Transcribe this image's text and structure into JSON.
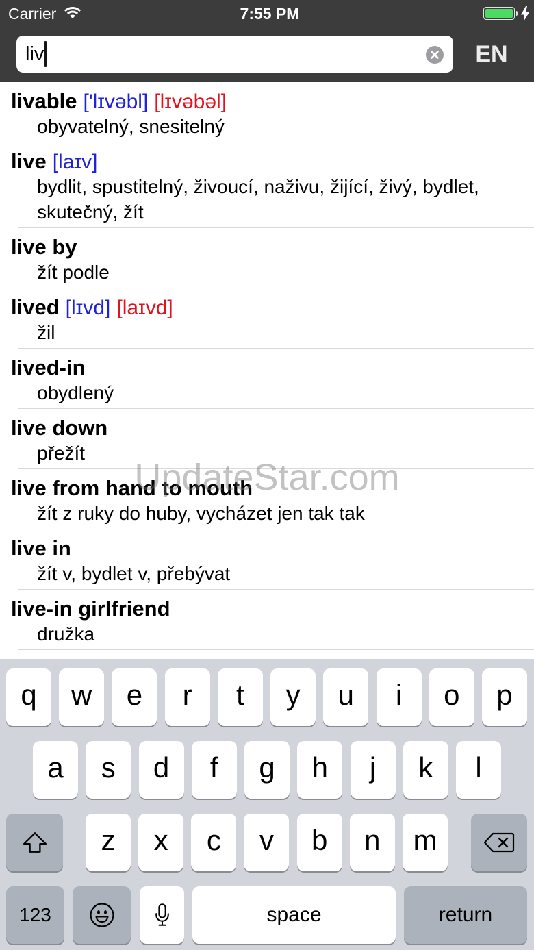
{
  "status_bar": {
    "carrier": "Carrier",
    "time": "7:55 PM",
    "wifi_icon": "wifi-icon",
    "battery_icon": "battery-icon",
    "charging_icon": "charging-bolt-icon",
    "battery_level": 1.0
  },
  "search": {
    "value": "liv",
    "clear_icon": "clear-icon",
    "language_button": "EN"
  },
  "results": [
    {
      "word": "livable",
      "pron_primary": "['lɪvəbl]",
      "pron_secondary": "[lɪvəbəl]",
      "translation": "obyvatelný, snesitelný"
    },
    {
      "word": "live",
      "pron_primary": "[laɪv]",
      "translation": "bydlit, spustitelný, živoucí, naživu, žijící, živý, bydlet, skutečný, žít"
    },
    {
      "word": "live by",
      "translation": "žít podle"
    },
    {
      "word": "lived",
      "pron_primary": "[lɪvd]",
      "pron_secondary": "[laɪvd]",
      "translation": "žil"
    },
    {
      "word": "lived-in",
      "translation": "obydlený"
    },
    {
      "word": "live down",
      "translation": "přežít"
    },
    {
      "word": "live from hand to mouth",
      "translation": "žít z ruky do huby, vycházet jen tak tak"
    },
    {
      "word": "live in",
      "translation": "žít v, bydlet v, přebývat"
    },
    {
      "word": "live-in girlfriend",
      "translation": "družka"
    }
  ],
  "watermark": "UpdateStar.com",
  "keyboard": {
    "row1": [
      "q",
      "w",
      "e",
      "r",
      "t",
      "y",
      "u",
      "i",
      "o",
      "p"
    ],
    "row2": [
      "a",
      "s",
      "d",
      "f",
      "g",
      "h",
      "j",
      "k",
      "l"
    ],
    "row3": [
      "z",
      "x",
      "c",
      "v",
      "b",
      "n",
      "m"
    ],
    "shift_icon": "shift-icon",
    "delete_icon": "delete-icon",
    "numbers_key": "123",
    "emoji_icon": "emoji-icon",
    "mic_icon": "microphone-icon",
    "space_key": "space",
    "return_key": "return"
  },
  "colors": {
    "header_bg": "#3c3c3c",
    "pron_primary": "#1e22d8",
    "pron_secondary": "#e3121c",
    "battery": "#4cd964",
    "keyboard_bg": "#d1d4da",
    "function_key_bg": "#abb2bb",
    "divider": "#d9d9d9"
  }
}
